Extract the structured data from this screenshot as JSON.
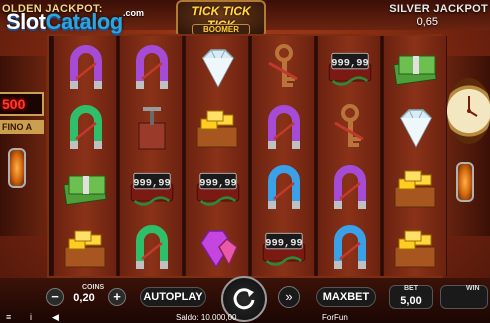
{
  "header": {
    "golden_jackpot_label": "OLDEN JACKPOT:",
    "silver_jackpot_label": "SILVER JACKPOT",
    "silver_jackpot_value": "0,65",
    "logo_title": "TICK TICK TICK",
    "logo_subtitle": "BOOMER"
  },
  "watermark": {
    "slot": "Slot",
    "catalog": "Catalog",
    "com": ".com"
  },
  "left_panel": {
    "jackpot_digits": "500",
    "fino_label": "FINO A"
  },
  "reels": [
    [
      "magnet-purple",
      "magnet-green",
      "cash-stack",
      "gold-bars"
    ],
    [
      "magnet-purple",
      "detonator",
      "timer-bomb",
      "magnet-green"
    ],
    [
      "diamond-white",
      "gold-bars",
      "timer-bomb",
      "gem-purple"
    ],
    [
      "key-brown",
      "magnet-purple",
      "magnet-blue",
      "timer-bomb"
    ],
    [
      "timer-bomb",
      "key-brown",
      "magnet-purple",
      "magnet-blue"
    ],
    [
      "cash-stack",
      "diamond-white",
      "gold-bars",
      "gold-bars"
    ]
  ],
  "bomb_display": "999,99",
  "footer": {
    "coins_label": "COINS",
    "coins_value": "0,20",
    "autoplay_label": "AUTOPLAY",
    "maxbet_label": "MAXBET",
    "bet_label": "BET",
    "bet_value": "5,00",
    "win_label": "WIN",
    "win_value": "",
    "saldo_text": "Saldo: 10.000,00",
    "forfun_text": "ForFun",
    "minus_symbol": "−",
    "plus_symbol": "+",
    "ff_symbol": "»",
    "menu_symbol": "≡",
    "info_symbol": "i",
    "sound_symbol": "◀"
  },
  "colors": {
    "accent_gold": "#ffd84a",
    "jackpot_red": "#ff3b2a",
    "background": "#8a2c12",
    "watermark_blue": "#2ca5e0"
  }
}
